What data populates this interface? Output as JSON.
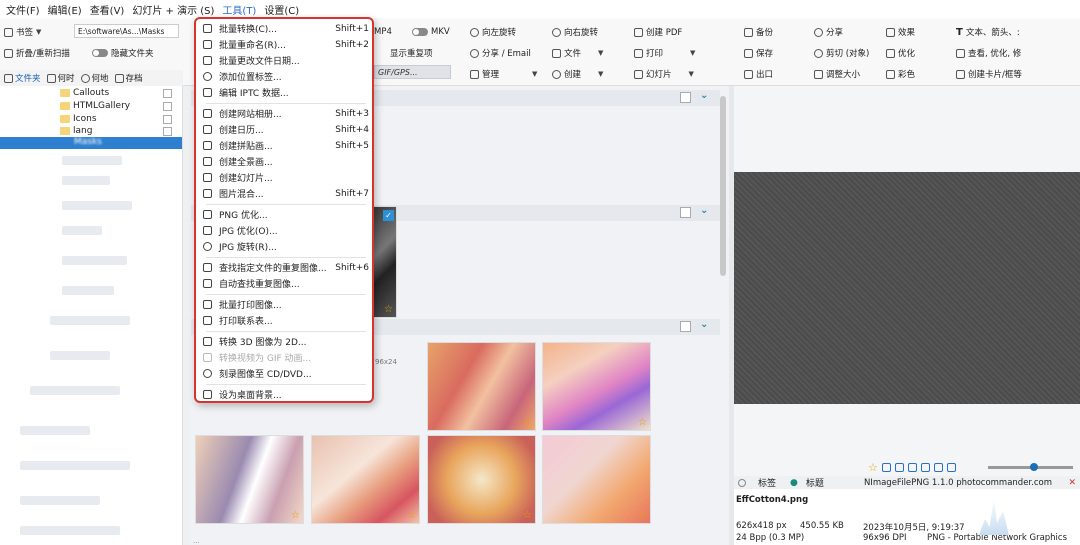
{
  "menubar": [
    "文件(F)",
    "编辑(E)",
    "查看(V)",
    "幻灯片 + 演示 (S)",
    "工具(T)",
    "设置(C)"
  ],
  "ribbon": {
    "bookmark": "书签",
    "address": "E:\\software\\As...\\Masks",
    "mp4": "MP4",
    "mkv": "MKV",
    "fold_rescan": "折叠/重新扫描",
    "hide_folders": "隐藏文件夹",
    "show_dupes": "显示重复项",
    "gif_gps": "GIF/GPS...",
    "rotate_left": "向左旋转",
    "rotate_right": "向右旋转",
    "create_pdf": "创建 PDF",
    "share_email": "分享 / Email",
    "file": "文件",
    "print": "打印",
    "manage": "管理",
    "create": "创建",
    "slideshow": "幻灯片",
    "backup": "备份",
    "share": "分享",
    "effects": "效果",
    "text_arrow": "文本、箭头、:",
    "save": "保存",
    "crop": "剪切 (对象)",
    "optimize": "优化",
    "view_opt": "查看, 优化, 修",
    "export": "出口",
    "resize": "调整大小",
    "color": "彩色",
    "create_card": "创建卡片/框等"
  },
  "lefttabs": [
    "文件夹",
    "何时",
    "何地",
    "存档"
  ],
  "tree": [
    "Callouts",
    "HTMLGallery",
    "Icons",
    "lang",
    "Masks"
  ],
  "menu": [
    {
      "label": "批量转换(C)...",
      "sc": "Shift+1"
    },
    {
      "label": "批量重命名(R)...",
      "sc": "Shift+2"
    },
    {
      "label": "批量更改文件日期...",
      "sc": ""
    },
    {
      "label": "添加位置标签...",
      "sc": ""
    },
    {
      "label": "编辑 IPTC 数据...",
      "sc": ""
    },
    {
      "label": "创建网站相册...",
      "sc": "Shift+3"
    },
    {
      "label": "创建日历...",
      "sc": "Shift+4"
    },
    {
      "label": "创建拼贴画...",
      "sc": "Shift+5"
    },
    {
      "label": "创建全景画...",
      "sc": ""
    },
    {
      "label": "创建幻灯片...",
      "sc": ""
    },
    {
      "label": "图片混合...",
      "sc": "Shift+7"
    },
    {
      "label": "PNG 优化...",
      "sc": ""
    },
    {
      "label": "JPG 优化(O)...",
      "sc": ""
    },
    {
      "label": "JPG 旋转(R)...",
      "sc": ""
    },
    {
      "label": "查找指定文件的重复图像...",
      "sc": "Shift+6"
    },
    {
      "label": "自动查找重复图像...",
      "sc": ""
    },
    {
      "label": "批量打印图像...",
      "sc": ""
    },
    {
      "label": "打印联系表...",
      "sc": ""
    },
    {
      "label": "转换 3D 图像为 2D...",
      "sc": ""
    },
    {
      "label": "转换视频为 GIF 动画...",
      "sc": ""
    },
    {
      "label": "刻录图像至 CD/DVD...",
      "sc": ""
    },
    {
      "label": "设为桌面背景...",
      "sc": ""
    }
  ],
  "grid": {
    "thumb_size": "96x24"
  },
  "preview": {
    "tab_labels": "标签",
    "tab_title": "标题",
    "plugin": "NImageFilePNG 1.1.0 photocommander.com",
    "filename": "EffCotton4.png",
    "dims": "626x418 px",
    "size": "450.55 KB",
    "date": "2023年10月5日, 9:19:37",
    "bpp": "24 Bpp (0.3 MP)",
    "dpi": "96x96 DPI",
    "format": "PNG - Portable Network Graphics"
  },
  "status": "  ..."
}
